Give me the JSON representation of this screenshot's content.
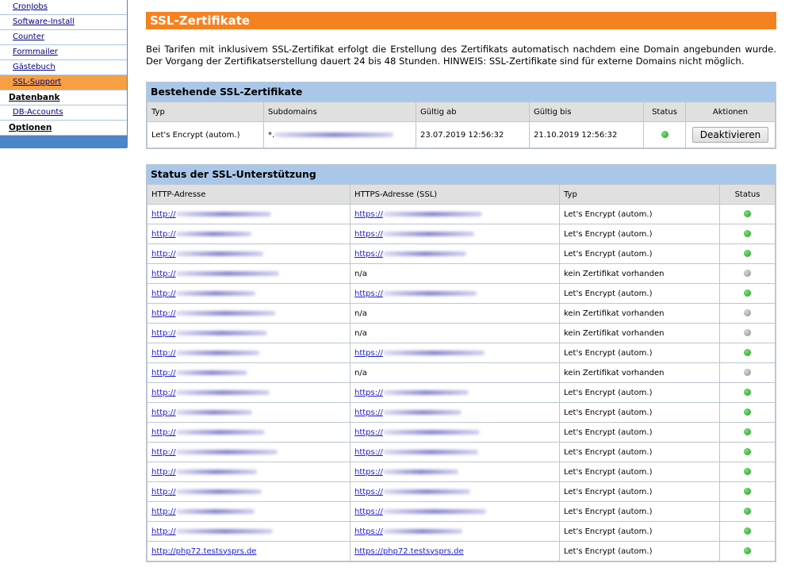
{
  "sidebar": {
    "items": [
      {
        "label": "CronJobs",
        "kind": "item",
        "active": false
      },
      {
        "label": "Software-Install",
        "kind": "item",
        "active": false
      },
      {
        "label": "Counter",
        "kind": "item",
        "active": false
      },
      {
        "label": "Formmailer",
        "kind": "item",
        "active": false
      },
      {
        "label": "Gästebuch",
        "kind": "item",
        "active": false
      },
      {
        "label": "SSL-Support",
        "kind": "item",
        "active": true
      },
      {
        "label": "Datenbank",
        "kind": "section",
        "active": false
      },
      {
        "label": "DB-Accounts",
        "kind": "item",
        "active": false
      },
      {
        "label": "Optionen",
        "kind": "section",
        "active": false
      }
    ]
  },
  "page": {
    "title": "SSL-Zertifikate",
    "intro": "Bei Tarifen mit inklusivem SSL-Zertifikat erfolgt die Erstellung des Zertifikats automatisch nachdem eine Domain angebunden wurde. Der Vorgang der Zertifikatserstellung dauert 24 bis 48 Stunden. HINWEIS: SSL-Zertifikate sind für externe Domains nicht möglich."
  },
  "existing": {
    "title": "Bestehende SSL-Zertifikate",
    "headers": {
      "type": "Typ",
      "subdomains": "Subdomains",
      "valid_from": "Gültig ab",
      "valid_to": "Gültig bis",
      "status": "Status",
      "actions": "Aktionen"
    },
    "rows": [
      {
        "type": "Let's Encrypt (autom.)",
        "subdomains": "*.",
        "valid_from": "23.07.2019 12:56:32",
        "valid_to": "21.10.2019 12:56:32",
        "status": "green",
        "action_label": "Deaktivieren"
      }
    ]
  },
  "status": {
    "title": "Status der SSL-Unterstützung",
    "headers": {
      "http": "HTTP-Adresse",
      "https": "HTTPS-Adresse (SSL)",
      "type": "Typ",
      "status": "Status"
    },
    "rows": [
      {
        "http": "http://",
        "https": "https://",
        "type": "Let's Encrypt (autom.)",
        "status": "green"
      },
      {
        "http": "http://",
        "https": "https://",
        "type": "Let's Encrypt (autom.)",
        "status": "green"
      },
      {
        "http": "http://",
        "https": "https://",
        "type": "Let's Encrypt (autom.)",
        "status": "green"
      },
      {
        "http": "http://",
        "https": "n/a",
        "type": "kein Zertifikat vorhanden",
        "status": "grey"
      },
      {
        "http": "http://",
        "https": "https://",
        "type": "Let's Encrypt (autom.)",
        "status": "green"
      },
      {
        "http": "http://",
        "https": "n/a",
        "type": "kein Zertifikat vorhanden",
        "status": "grey"
      },
      {
        "http": "http://",
        "https": "n/a",
        "type": "kein Zertifikat vorhanden",
        "status": "grey"
      },
      {
        "http": "http://",
        "https": "https://",
        "type": "Let's Encrypt (autom.)",
        "status": "green"
      },
      {
        "http": "http://",
        "https": "n/a",
        "type": "kein Zertifikat vorhanden",
        "status": "grey"
      },
      {
        "http": "http://",
        "https": "https://",
        "type": "Let's Encrypt (autom.)",
        "status": "green"
      },
      {
        "http": "http://",
        "https": "https://",
        "type": "Let's Encrypt (autom.)",
        "status": "green"
      },
      {
        "http": "http://",
        "https": "https://",
        "type": "Let's Encrypt (autom.)",
        "status": "green"
      },
      {
        "http": "http://",
        "https": "https://",
        "type": "Let's Encrypt (autom.)",
        "status": "green"
      },
      {
        "http": "http://",
        "https": "https://",
        "type": "Let's Encrypt (autom.)",
        "status": "green"
      },
      {
        "http": "http://",
        "https": "https://",
        "type": "Let's Encrypt (autom.)",
        "status": "green"
      },
      {
        "http": "http://",
        "https": "https://",
        "type": "Let's Encrypt (autom.)",
        "status": "green"
      },
      {
        "http": "http://",
        "https": "https://",
        "type": "Let's Encrypt (autom.)",
        "status": "green"
      },
      {
        "http": "http://php72.testsysprs.de",
        "https": "https://php72.testsysprs.de",
        "type": "Let's Encrypt (autom.)",
        "status": "green"
      }
    ]
  },
  "colors": {
    "accent_orange": "#f58220",
    "active_nav": "#f7a043",
    "sidebar_blue": "#4a86c8",
    "header_blue": "#a9c8e9",
    "status_ok": "#1f9a25",
    "status_none": "#8a8a8a"
  }
}
